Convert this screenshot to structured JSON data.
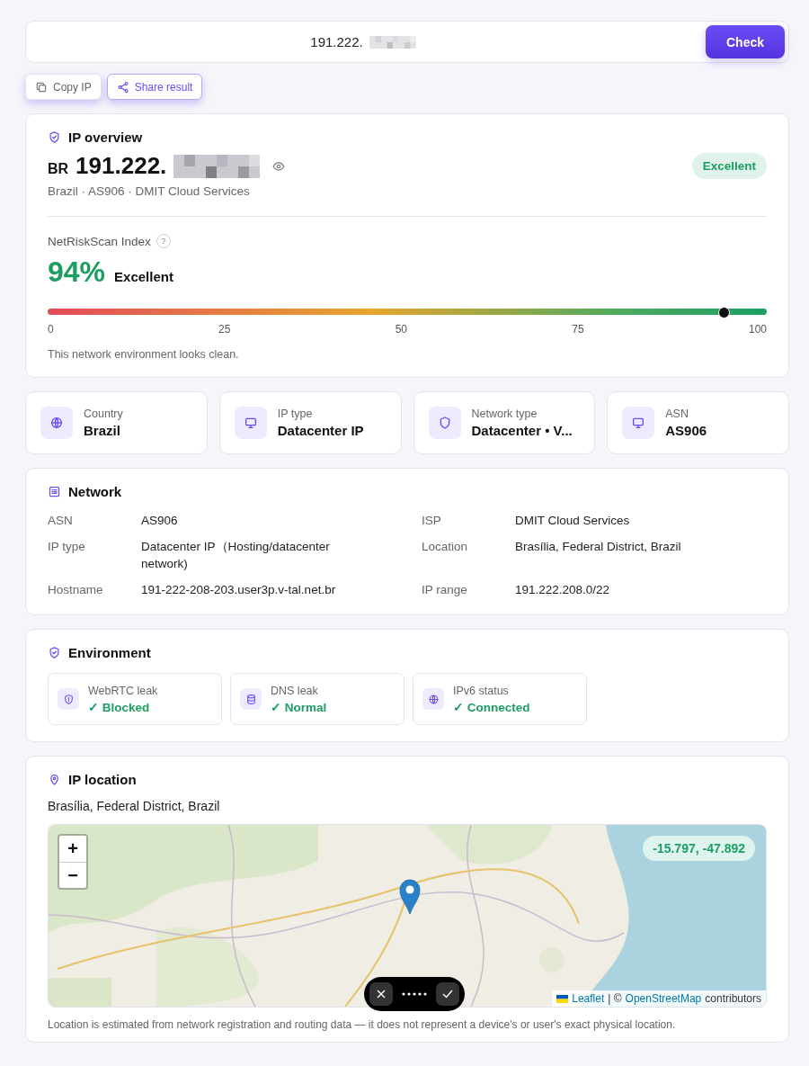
{
  "search": {
    "value": "191.222.",
    "redacted": true,
    "button": "Check"
  },
  "actions": [
    {
      "kind": "copy",
      "label": "Copy IP"
    },
    {
      "kind": "share",
      "label": "Share result"
    }
  ],
  "overview": {
    "title": "IP overview",
    "country_code": "BR",
    "ip": "191.222.",
    "redacted": true,
    "subtitle": "Brazil · AS906 · DMIT Cloud Services",
    "badge": "Excellent",
    "index_label": "NetRiskScan Index",
    "help": "?",
    "score": "94%",
    "rating": "Excellent",
    "level": 0.94,
    "ticks": [
      "0",
      "25",
      "50",
      "75",
      "100"
    ],
    "note": "This network environment looks clean."
  },
  "stats": [
    {
      "kind": "globe",
      "label": "Country",
      "value": "Brazil"
    },
    {
      "kind": "monitor",
      "label": "IP type",
      "value": "Datacenter IP"
    },
    {
      "kind": "shield",
      "label": "Network type",
      "value": "Datacenter • V..."
    },
    {
      "kind": "monitor",
      "label": "ASN",
      "value": "AS906"
    }
  ],
  "network": {
    "title": "Network",
    "rows": [
      {
        "label": "ASN",
        "value": "AS906"
      },
      {
        "label": "ISP",
        "value": "DMIT Cloud Services"
      },
      {
        "label": "IP type",
        "value": "Datacenter IP（Hosting/datacenter network)"
      },
      {
        "label": "Location",
        "value": "Brasília, Federal District, Brazil"
      },
      {
        "label": "Hostname",
        "value": "191-222-208-203.user3p.v-tal.net.br"
      },
      {
        "label": "IP range",
        "value": "191.222.208.0/22"
      }
    ]
  },
  "environment": {
    "title": "Environment",
    "items": [
      {
        "kind": "shield",
        "label": "WebRTC leak",
        "status": "✓ Blocked"
      },
      {
        "kind": "database",
        "label": "DNS leak",
        "status": "✓ Normal"
      },
      {
        "kind": "globe",
        "label": "IPv6 status",
        "status": "✓ Connected"
      }
    ]
  },
  "location": {
    "title": "IP location",
    "place": "Brasília, Federal District, Brazil",
    "coords": "-15.797, -47.892",
    "zoom_in": "+",
    "zoom_out": "−",
    "attribution": {
      "link_1": "Leaflet",
      "separator": "| ©",
      "link_2": "OpenStreetMap",
      "suffix": "contributors"
    },
    "footnote": "Location is estimated from network registration and routing data — it does not represent a device's or user's exact physical location."
  }
}
